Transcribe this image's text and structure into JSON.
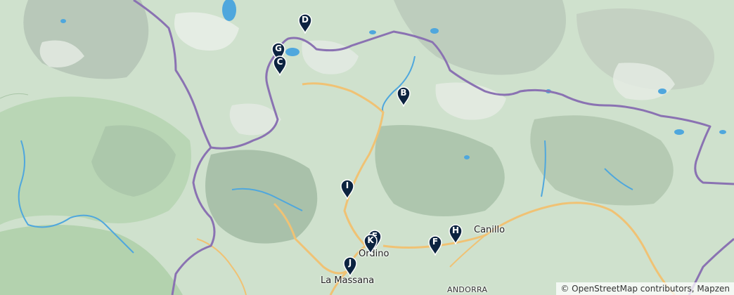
{
  "map": {
    "places": [
      {
        "id": "canillo",
        "name": "Canillo"
      },
      {
        "id": "ordino",
        "name": "Ordino"
      },
      {
        "id": "la-massana",
        "name": "La Massana"
      },
      {
        "id": "andorra",
        "name": "ANDORRA"
      }
    ],
    "markers": [
      {
        "id": "d",
        "label": "D"
      },
      {
        "id": "g",
        "label": "G"
      },
      {
        "id": "c",
        "label": "C"
      },
      {
        "id": "b",
        "label": "B"
      },
      {
        "id": "i",
        "label": "I"
      },
      {
        "id": "e",
        "label": "E"
      },
      {
        "id": "k",
        "label": "K"
      },
      {
        "id": "h",
        "label": "H"
      },
      {
        "id": "f",
        "label": "F"
      },
      {
        "id": "j",
        "label": "J"
      }
    ],
    "marker_color": "#0c2340",
    "border_color": "#8a72b2",
    "road_color": "#f0c274",
    "water_color": "#4fa7dd",
    "attribution": "© OpenStreetMap contributors, Mapzen"
  }
}
